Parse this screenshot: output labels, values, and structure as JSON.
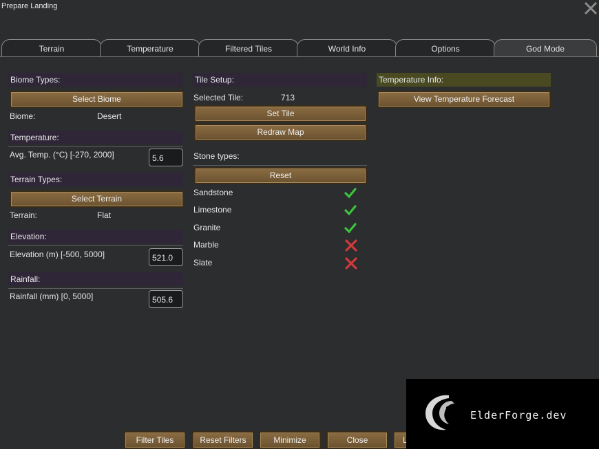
{
  "window": {
    "title": "Prepare Landing",
    "close_icon": "close-x-icon"
  },
  "tabs": [
    {
      "label": "Terrain",
      "active": false
    },
    {
      "label": "Temperature",
      "active": false
    },
    {
      "label": "Filtered Tiles",
      "active": false
    },
    {
      "label": "World Info",
      "active": false
    },
    {
      "label": "Options",
      "active": false
    },
    {
      "label": "God Mode",
      "active": true
    }
  ],
  "left": {
    "biome_header": "Biome Types:",
    "select_biome": "Select Biome",
    "biome_label": "Biome:",
    "biome_value": "Desert",
    "temperature_header": "Temperature:",
    "avg_temp_label": "Avg. Temp. (°C) [-270, 2000]",
    "avg_temp_value": "5.6",
    "terrain_header": "Terrain Types:",
    "select_terrain": "Select Terrain",
    "terrain_label": "Terrain:",
    "terrain_value": "Flat",
    "elevation_header": "Elevation:",
    "elevation_label": "Elevation (m) [-500, 5000]",
    "elevation_value": "521.0",
    "rainfall_header": "Rainfall:",
    "rainfall_label": "Rainfall (mm) [0, 5000]",
    "rainfall_value": "505.6"
  },
  "middle": {
    "tile_setup_header": "Tile Setup:",
    "selected_tile_label": "Selected Tile:",
    "selected_tile_value": "713",
    "set_tile": "Set Tile",
    "redraw_map": "Redraw Map",
    "stone_types_header": "Stone types:",
    "reset": "Reset",
    "stones": [
      {
        "name": "Sandstone",
        "enabled": true
      },
      {
        "name": "Limestone",
        "enabled": true
      },
      {
        "name": "Granite",
        "enabled": true
      },
      {
        "name": "Marble",
        "enabled": false
      },
      {
        "name": "Slate",
        "enabled": false
      }
    ]
  },
  "right": {
    "temperature_info_header": "Temperature Info:",
    "view_forecast": "View Temperature Forecast"
  },
  "bottom_buttons": [
    {
      "label": "Filter Tiles"
    },
    {
      "label": "Reset Filters"
    },
    {
      "label": "Minimize"
    },
    {
      "label": "Close"
    },
    {
      "label": "L"
    }
  ],
  "watermark": {
    "text": "ElderForge.dev",
    "icon": "dragon-logo-icon"
  },
  "colors": {
    "background": "#2b2d2e",
    "section_purple": "#2f2638",
    "section_gold": "#4a4a22",
    "button_brown": "#7a5e38",
    "check_green": "#3cc43c",
    "cross_red": "#d23a3a"
  }
}
